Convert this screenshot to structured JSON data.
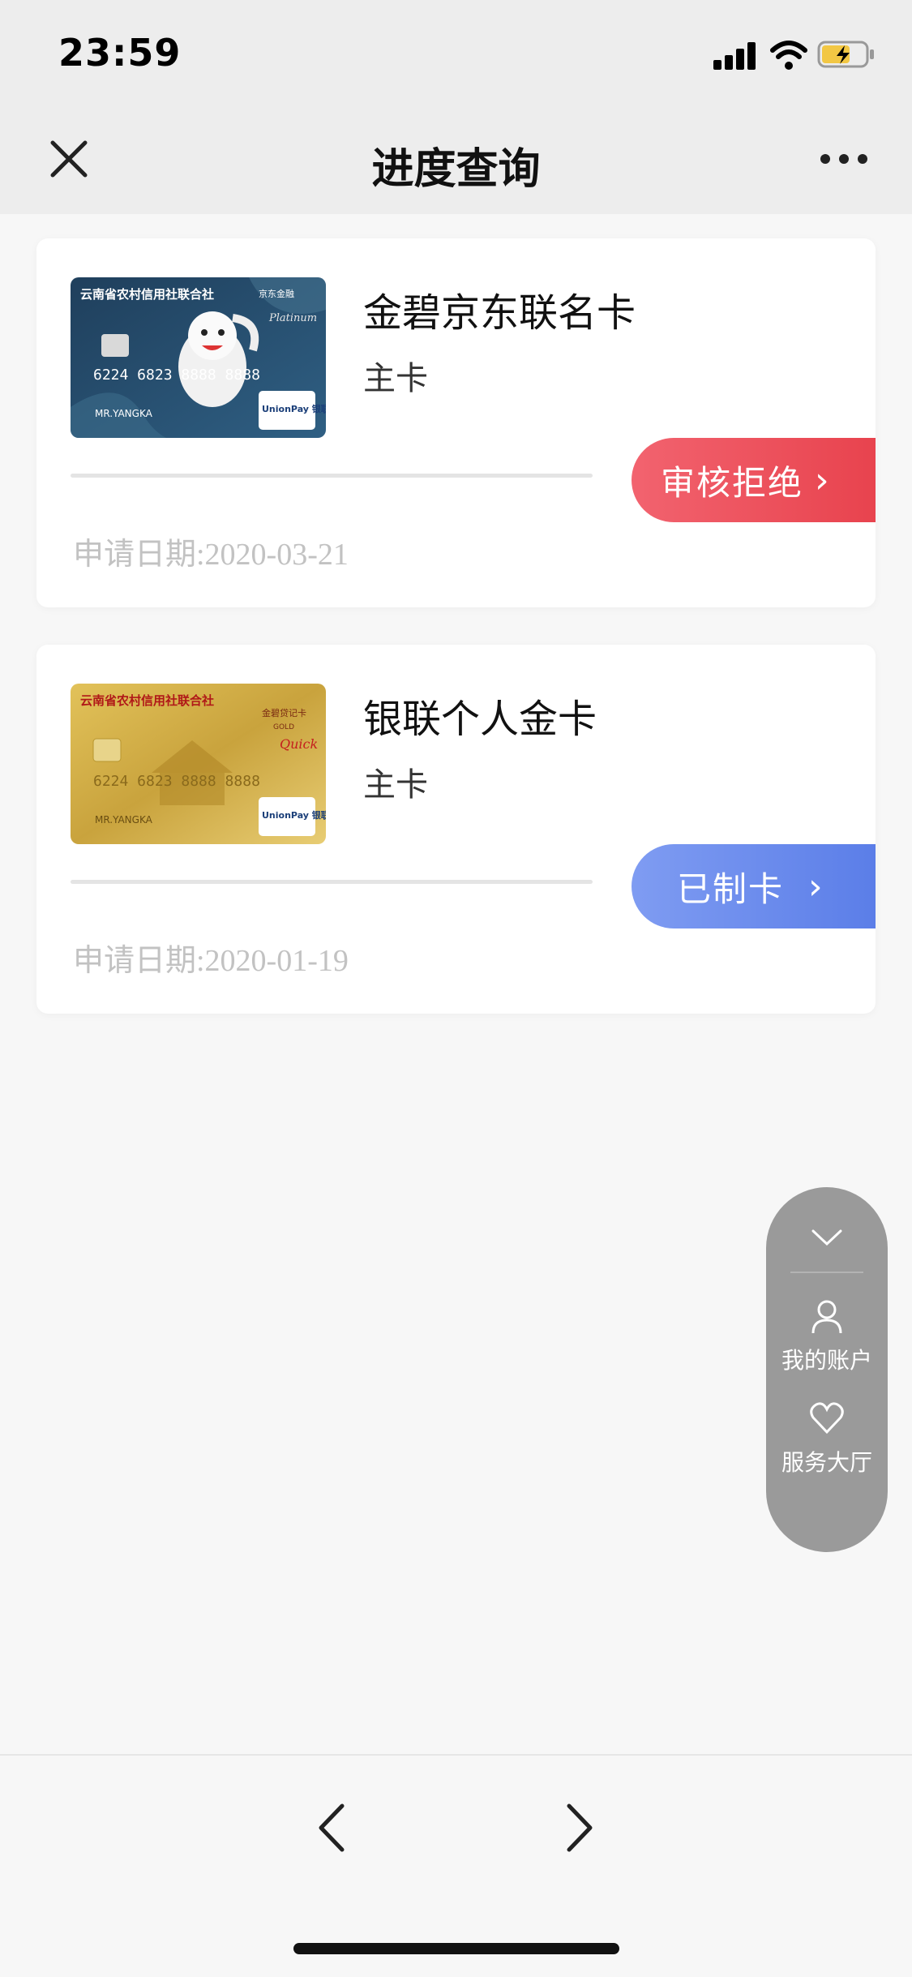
{
  "status_bar": {
    "time": "23:59"
  },
  "header": {
    "title": "进度查询"
  },
  "cards": [
    {
      "name": "金碧京东联名卡",
      "type": "主卡",
      "status": "审核拒绝",
      "status_color": "#ec4f59",
      "date": "申请日期:2020-03-21",
      "image": {
        "bank_name": "云南省农村信用社联合社",
        "brand": "京东金融",
        "tier": "Platinum",
        "number": "6224 6823 8888 8888",
        "holder": "MR.YANGKA",
        "network": "UnionPay 银联"
      }
    },
    {
      "name": "银联个人金卡",
      "type": "主卡",
      "status": "已制卡",
      "status_color": "#6a8bee",
      "date": "申请日期:2020-01-19",
      "image": {
        "bank_name": "云南省农村信用社联合社",
        "brand": "金碧贷记卡",
        "tier": "GOLD",
        "number": "6224 6823 8888 8888",
        "holder": "MR.YANGKA",
        "network": "UnionPay 银联"
      }
    }
  ],
  "float_menu": {
    "items": [
      {
        "label": "我的账户",
        "icon": "user-icon"
      },
      {
        "label": "服务大厅",
        "icon": "heart-hands-icon"
      }
    ]
  }
}
